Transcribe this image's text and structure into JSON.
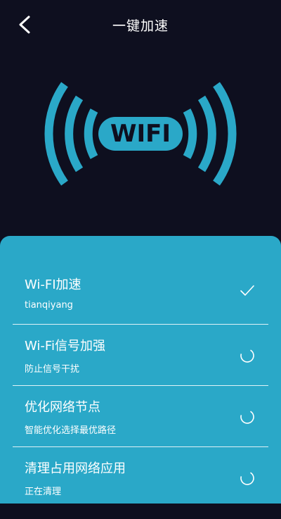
{
  "header": {
    "title": "一键加速"
  },
  "hero": {
    "label": "WIFI"
  },
  "items": [
    {
      "name": "Wi-FI加速",
      "sub": "tianqiyang",
      "status": "done"
    },
    {
      "name": "Wi-Fi信号加强",
      "sub": "防止信号干扰",
      "status": "loading"
    },
    {
      "name": "优化网络节点",
      "sub": "智能优化选择最优路径",
      "status": "loading"
    },
    {
      "name": "清理占用网络应用",
      "sub": "正在清理",
      "status": "loading"
    }
  ],
  "colors": {
    "background": "#0e0f1f",
    "accent": "#2aa8c8",
    "text": "#ffffff"
  }
}
